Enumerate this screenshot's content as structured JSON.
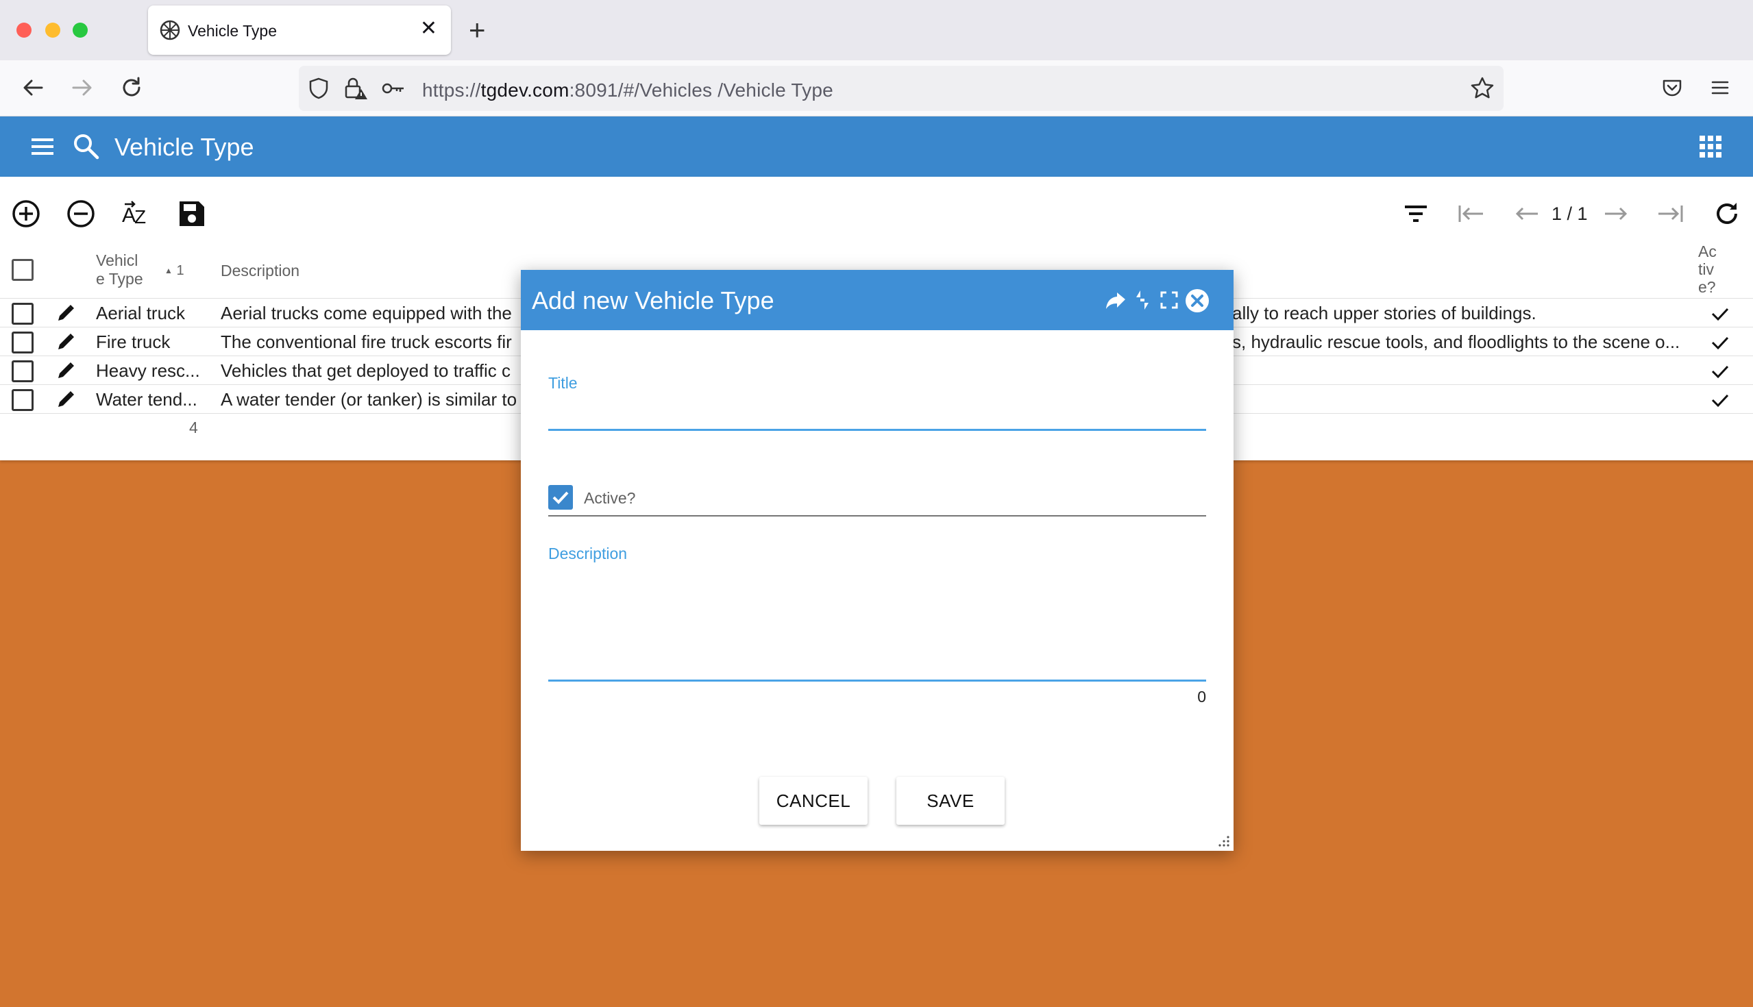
{
  "browser": {
    "tab_title": "Vehicle Type",
    "url_prefix": "https://",
    "url_host": "tgdev.com",
    "url_rest": ":8091/#/Vehicles /Vehicle Type",
    "traffic_colors": [
      "#ff5f57",
      "#febc2e",
      "#28c840"
    ]
  },
  "app": {
    "title": "Vehicle Type",
    "header_color": "#3a87cc",
    "background_color": "#d2752f"
  },
  "toolbar": {
    "pager_text": "1 / 1"
  },
  "grid": {
    "col_vehicle_type": "Vehicl\ne Type",
    "sort_indicator": "1",
    "col_description": "Description",
    "col_active": "Ac\ntiv\ne?",
    "footer_count": "4",
    "rows": [
      {
        "vehicle_type": "Aerial truck",
        "description_left": "Aerial trucks come equipped with the",
        "description_right": "ally to reach upper stories of buildings.",
        "active": true
      },
      {
        "vehicle_type": "Fire truck",
        "description_left": "The conventional fire truck escorts fir",
        "description_right": "s, hydraulic rescue tools, and floodlights to the scene o...",
        "active": true
      },
      {
        "vehicle_type": "Heavy resc...",
        "description_left": "Vehicles that get deployed to traffic c",
        "description_right": "",
        "active": true
      },
      {
        "vehicle_type": "Water tend...",
        "description_left": "A water tender (or tanker) is similar to",
        "description_right": "",
        "active": true
      }
    ]
  },
  "dialog": {
    "title": "Add new Vehicle Type",
    "header_color": "#3f8fd6",
    "title_label": "Title",
    "title_value": "",
    "active_label": "Active?",
    "active_checked": true,
    "description_label": "Description",
    "description_value": "",
    "char_count": "0",
    "cancel_label": "CANCEL",
    "save_label": "SAVE"
  }
}
